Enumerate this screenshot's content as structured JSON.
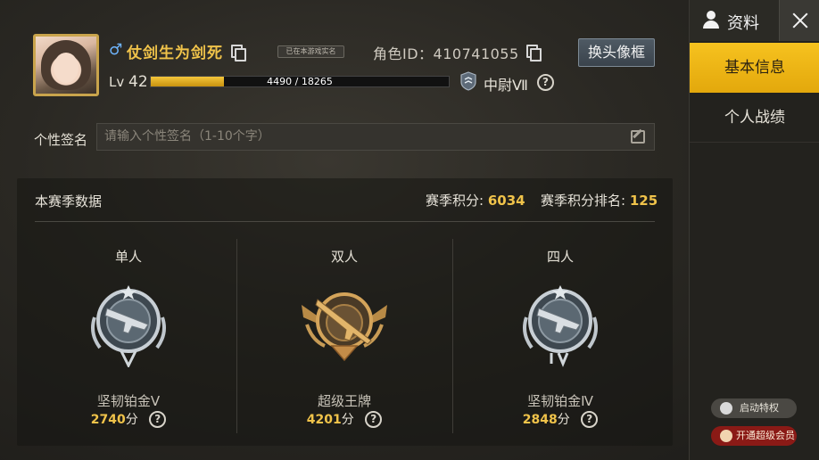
{
  "profile": {
    "gender_symbol": "♂",
    "nickname": "仗剑生为剑死",
    "tag": "已在本游戏实名",
    "role_id": "角色ID：410741055",
    "avatar_frame_button": "换头像框",
    "level_prefix": "Lv",
    "level": "42",
    "xp_text": "4490 / 18265",
    "xp_fraction": 0.2458,
    "rank": "中尉Ⅶ"
  },
  "signature": {
    "label": "个性签名",
    "placeholder": "请输入个性签名（1-10个字）"
  },
  "season": {
    "title": "本赛季数据",
    "points_label": "赛季积分:",
    "points": "6034",
    "rank_label": "赛季积分排名:",
    "rank": "125",
    "modes": [
      {
        "name": "单人",
        "tier": "坚韧铂金Ⅴ",
        "score": "2740",
        "unit": "分",
        "badge": "platinum-v-badge"
      },
      {
        "name": "双人",
        "tier": "超级王牌",
        "score": "4201",
        "unit": "分",
        "badge": "super-ace-badge"
      },
      {
        "name": "四人",
        "tier": "坚韧铂金Ⅳ",
        "score": "2848",
        "unit": "分",
        "badge": "platinum-iv-badge"
      }
    ]
  },
  "sidebar": {
    "title": "资料",
    "tabs": [
      "基本信息",
      "个人战绩"
    ],
    "privilege_button": "启动特权",
    "vip_button": "开通超级会员"
  },
  "colors": {
    "accent_gold": "#f0c34a",
    "active_tab": "#f6c21f",
    "vip_red": "#8a1a16"
  }
}
